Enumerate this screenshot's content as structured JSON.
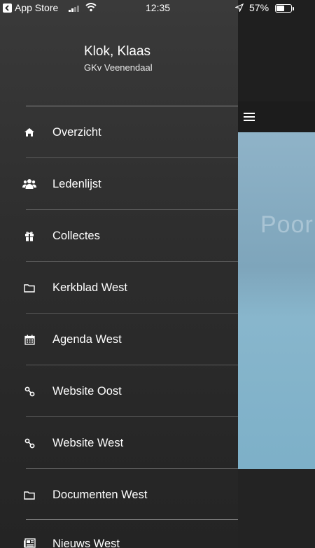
{
  "status_bar": {
    "back_app": "App Store",
    "time": "12:35",
    "battery_percent": "57%",
    "battery_level": 0.57,
    "signal_bars": 2
  },
  "profile": {
    "name": "Klok, Klaas",
    "organization": "GKv Veenendaal"
  },
  "menu": {
    "items": [
      {
        "label": "Overzicht",
        "icon": "home-icon"
      },
      {
        "label": "Ledenlijst",
        "icon": "users-icon"
      },
      {
        "label": "Collectes",
        "icon": "gift-icon"
      },
      {
        "label": "Kerkblad West",
        "icon": "folder-icon"
      },
      {
        "label": "Agenda West",
        "icon": "calendar-icon"
      },
      {
        "label": "Website Oost",
        "icon": "link-icon"
      },
      {
        "label": "Website West",
        "icon": "link-icon"
      },
      {
        "label": "Documenten West",
        "icon": "folder-icon"
      },
      {
        "label": "Nieuws West",
        "icon": "newspaper-icon"
      }
    ]
  },
  "content": {
    "hero_text": "Poor"
  },
  "colors": {
    "drawer_top": "#3a3a3a",
    "drawer_bottom": "#242424",
    "hero_blue": "#7ea5bb",
    "text": "#ffffff"
  }
}
